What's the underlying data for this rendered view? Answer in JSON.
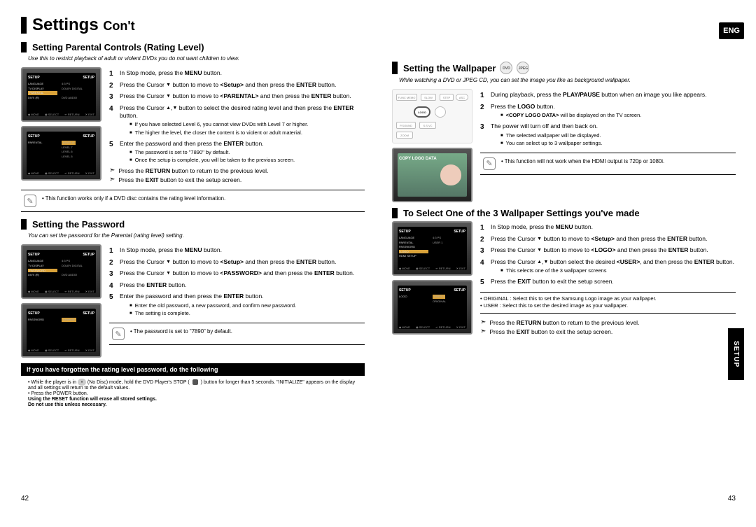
{
  "lang_badge": "ENG",
  "side_tab": "SETUP",
  "page_num_left": "42",
  "page_num_right": "43",
  "main_title": "Settings",
  "main_title_sub": "Con't",
  "left": {
    "sec1": {
      "title": "Setting Parental Controls (Rating Level)",
      "intro": "Use this to restrict playback of adult or violent DVDs you do not want children to view.",
      "steps": {
        "s1": "In Stop mode, press the MENU button.",
        "s2": "Press the Cursor ▼ button to move to <Setup> and then press the ENTER button.",
        "s3": "Press the Cursor ▼ button to move to <PARENTAL> and then press the ENTER button.",
        "s4": "Press the Cursor ▲,▼ button to select the desired rating level and then press the ENTER button.",
        "s4_sub1": "If you have selected Level 6, you cannot view DVDs with Level 7 or higher.",
        "s4_sub2": "The higher the level, the closer the content is to violent or adult material.",
        "s5": "Enter the password and then press the ENTER button.",
        "s5_sub1": "The password is set to \"7890\" by default.",
        "s5_sub2": "Once the setup is complete, you will be taken to the previous screen.",
        "tip1": "Press the RETURN button to return to the previous level.",
        "tip2": "Press the EXIT button to exit the setup screen.",
        "note1": "This function works only if a DVD disc contains the rating level information."
      }
    },
    "sec2": {
      "title": "Setting the Password",
      "intro": "You can set the password for the Parental (rating level) setting.",
      "steps": {
        "s1": "In Stop mode, press the MENU button.",
        "s2": "Press the Cursor ▼ button to move to <Setup> and then press the ENTER button.",
        "s3": "Press the Cursor ▼ button to move to <PASSWORD> and then press the ENTER button.",
        "s4": "Press the ENTER button.",
        "s5": "Enter the password and then press the ENTER button.",
        "s5_sub1": "Enter the old password, a new password, and confirm new password.",
        "s5_sub2": "The setting is complete.",
        "note1": "The password is set to \"7890\" by default."
      }
    },
    "blackband": "If you have forgotten the rating level password, do the following",
    "footnotes": {
      "f1a": "While the player is in",
      "f1b": "(No Disc) mode, hold the DVD Player's STOP (",
      "f1c": ") button for longer than 5 seconds. \"INITIALIZE\" appears on the display and all settings will return to the default values.",
      "f2": "Press the POWER button.",
      "f3": "Using the RESET function will erase all stored settings.",
      "f4": "Do not use this unless necessary."
    }
  },
  "right": {
    "sec1": {
      "title": "Setting the Wallpaper",
      "badge1": "DVD",
      "badge2": "JPEG",
      "intro": "While watching a DVD or JPEG CD, you can set the image you like as background wallpaper.",
      "steps": {
        "s1": "During playback, press the PLAY/PAUSE button when an image you like appears.",
        "s2": "Press the LOGO button.",
        "s2_sub1": "<COPY LOGO DATA> will be displayed on the TV screen.",
        "s3": "The power will turn off and then back on.",
        "s3_sub1": "The selected wallpaper will be displayed.",
        "s3_sub2": "You can select up to 3 wallpaper settings.",
        "note1": "This function will not work when the HDMI output is 720p or 1080i."
      }
    },
    "sec2": {
      "title": "To Select One of the 3 Wallpaper Settings you've made",
      "steps": {
        "s1": "In Stop mode, press the MENU button.",
        "s2": "Press the Cursor ▼ button to move to <Setup> and then press the ENTER button.",
        "s3": "Press the Cursor ▼ button to move to <LOGO> and then press the ENTER button.",
        "s4": "Press the Cursor ▲,▼ button select the desired <USER>, and then press the ENTER button.",
        "s4_sub1": "This selects one of the 3 wallpaper screens",
        "s5": "Press the EXIT button to exit the setup screen.",
        "bullet1": "ORIGINAL : Select this to set the Samsung Logo image as your wallpaper.",
        "bullet2": "USER : Select this to set the desired image as your wallpaper.",
        "tip1": "Press the RETURN button to return to the previous level.",
        "tip2": "Press the EXIT button to exit the setup screen."
      }
    }
  },
  "thumb": {
    "setup_header_l": "SETUP",
    "setup_header_r": "SETUP",
    "lang": "LANGUAGE",
    "tv": "TV DISPLAY",
    "parental": "PARENTAL",
    "password": "PASSWORD",
    "divx": "DIVX (R)",
    "logo": "LOGO",
    "hdmi": "HDMI SETUP",
    "change": "CHANGE",
    "val_4_3ps": "4:3 PS",
    "val_dolby": "DOLBY DIGITAL",
    "val_dvd": "DVD AUDIO",
    "val_level8": "LEVEL 8",
    "val_level7": "LEVEL 7",
    "val_level6": "LEVEL 6",
    "val_level5": "LEVEL 5",
    "val_user1": "USER 1",
    "val_original": "ORIGINAL",
    "footer_move": "MOVE",
    "footer_select": "SELECT",
    "footer_return": "RETURN",
    "footer_exit": "EXIT",
    "copy_logo": "COPY LOGO DATA",
    "ctrl_funcmemo": "FUNC MEMO",
    "ctrl_slow": "SLOW",
    "ctrl_step": "STEP",
    "ctrl_logo": "LOGO",
    "ctrl_psound": "P.SOUND",
    "ctrl_sssvc": "S.S.VC",
    "ctrl_zoom": "ZOOM",
    "ctrl_asc": "ASC"
  }
}
